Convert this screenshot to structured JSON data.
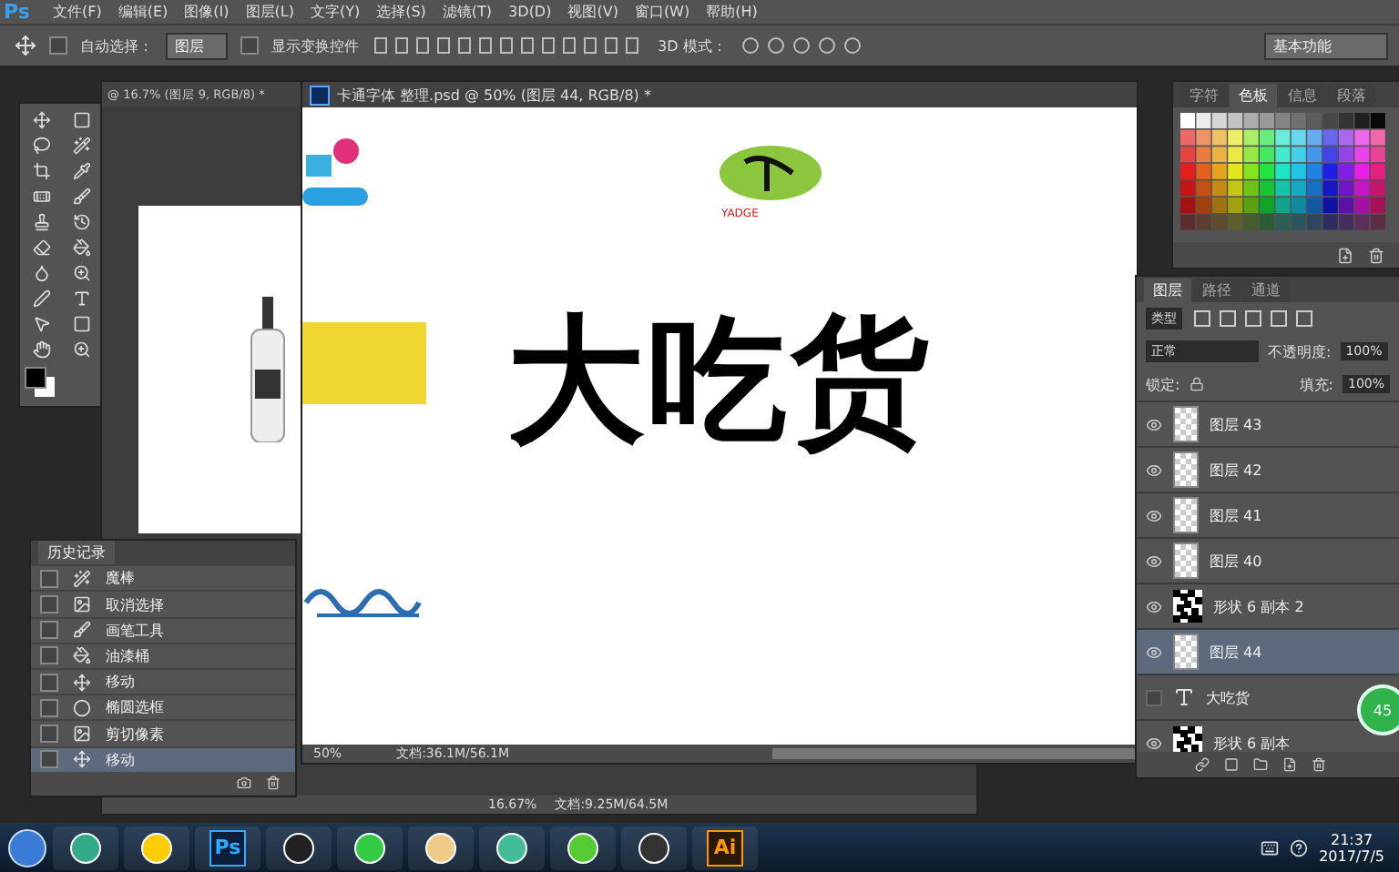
{
  "menu_bar": {
    "logo": "Ps",
    "items": [
      "文件(F)",
      "编辑(E)",
      "图像(I)",
      "图层(L)",
      "文字(Y)",
      "选择(S)",
      "滤镜(T)",
      "3D(D)",
      "视图(V)",
      "窗口(W)",
      "帮助(H)"
    ]
  },
  "options_bar": {
    "auto_select": {
      "label": "自动选择：",
      "checked": false,
      "value": "图层"
    },
    "show_transform": {
      "label": "显示变换控件",
      "checked": false
    },
    "mode_3d": "3D 模式：",
    "workspace": "基本功能"
  },
  "back_document": {
    "title": "@ 16.7% (图层 9, RGB/8) *",
    "zoom": "16.67%",
    "doc_info": "文档:9.25M/64.5M"
  },
  "document": {
    "title": "卡通字体 整理.psd @ 50% (图层 44, RGB/8) *",
    "headline": "大吃货",
    "logo_text": "YADGE",
    "zoom": "50%",
    "doc_info": "文档:36.1M/56.1M"
  },
  "swatches_panel": {
    "tabs": [
      {
        "label": "字符",
        "selected": false
      },
      {
        "label": "色板",
        "selected": true
      },
      {
        "label": "信息",
        "selected": false
      },
      {
        "label": "段落",
        "selected": false
      }
    ]
  },
  "layers_panel": {
    "tabs": [
      {
        "label": "图层",
        "selected": true
      },
      {
        "label": "路径",
        "selected": false
      },
      {
        "label": "通道",
        "selected": false
      }
    ],
    "filter": "类型",
    "blend_mode": "正常",
    "opacity_label": "不透明度:",
    "opacity": "100%",
    "lock_label": "锁定:",
    "fill_label": "填充:",
    "fill": "100%",
    "layers": [
      {
        "name": "图层 43",
        "kind": "pixel",
        "visible": true,
        "selected": false
      },
      {
        "name": "图层 42",
        "kind": "pixel",
        "visible": true,
        "selected": false
      },
      {
        "name": "图层 41",
        "kind": "pixel",
        "visible": true,
        "selected": false
      },
      {
        "name": "图层 40",
        "kind": "pixel",
        "visible": true,
        "selected": false
      },
      {
        "name": "形状 6 副本 2",
        "kind": "shape",
        "visible": true,
        "selected": false
      },
      {
        "name": "图层 44",
        "kind": "pixel",
        "visible": true,
        "selected": true
      },
      {
        "name": "大吃货",
        "kind": "text",
        "visible": false,
        "selected": false
      },
      {
        "name": "形状 6 副本",
        "kind": "shape",
        "visible": true,
        "selected": false
      }
    ]
  },
  "history_panel": {
    "title": "历史记录",
    "items": [
      {
        "label": "魔棒",
        "kind": "wand",
        "selected": false
      },
      {
        "label": "取消选择",
        "kind": "doc",
        "selected": false
      },
      {
        "label": "画笔工具",
        "kind": "brush",
        "selected": false
      },
      {
        "label": "油漆桶",
        "kind": "bucket",
        "selected": false
      },
      {
        "label": "移动",
        "kind": "move",
        "selected": false
      },
      {
        "label": "椭圆选框",
        "kind": "ellipse",
        "selected": false
      },
      {
        "label": "剪切像素",
        "kind": "doc",
        "selected": false
      },
      {
        "label": "移动",
        "kind": "move",
        "selected": true
      }
    ]
  },
  "badge": "45",
  "taskbar": {
    "apps": [
      {
        "kind": "pinwheel"
      },
      {
        "kind": "ring"
      },
      {
        "kind": "ps",
        "label": "Ps"
      },
      {
        "kind": "penguin"
      },
      {
        "kind": "browser"
      },
      {
        "kind": "folder"
      },
      {
        "kind": "cube"
      },
      {
        "kind": "chat"
      },
      {
        "kind": "obs"
      },
      {
        "kind": "ai",
        "label": "Ai"
      }
    ],
    "time": "21:37",
    "date": "2017/7/5"
  }
}
